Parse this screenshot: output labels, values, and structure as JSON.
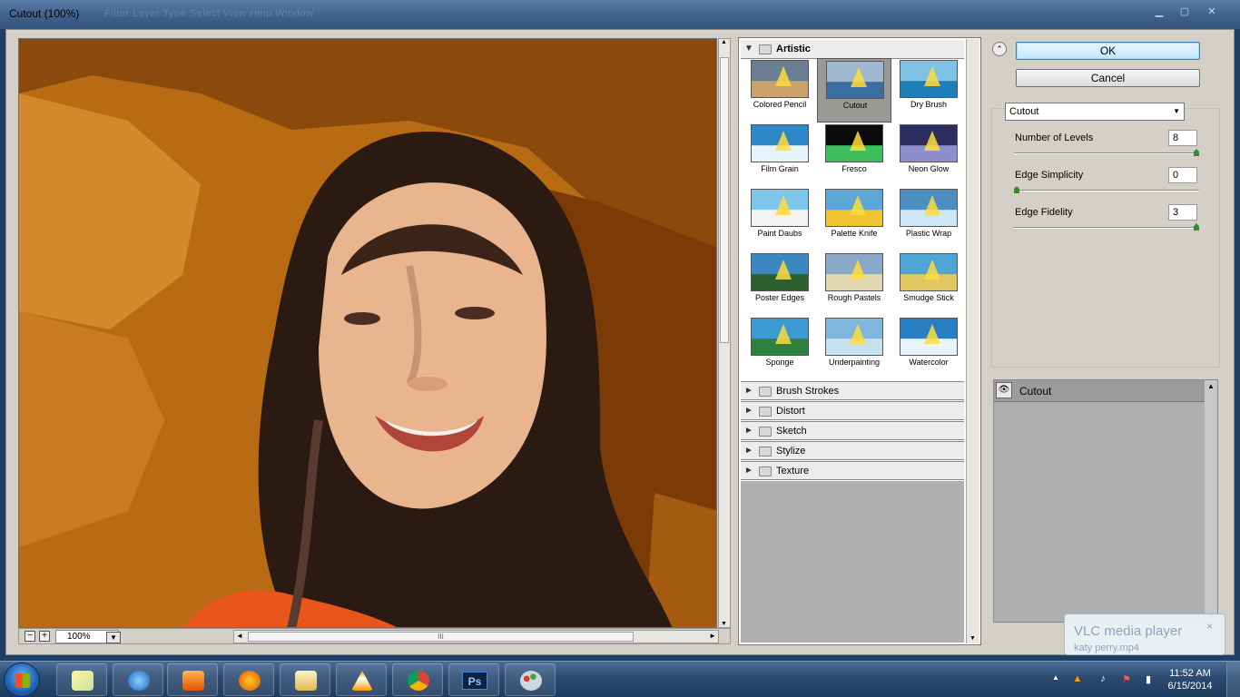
{
  "window": {
    "title": "Cutout (100%)",
    "ghost_menu": "Filter   Layer   Type   Select   View   Help   Window"
  },
  "preview": {
    "zoom_value": "100%",
    "zoom_out_glyph": "−",
    "zoom_in_glyph": "+",
    "dropdown_glyph": "▼",
    "hscroll_glyph": "III",
    "vscroll_up": "▲",
    "vscroll_down": "▼",
    "hscroll_left": "◄",
    "hscroll_right": "►"
  },
  "gallery": {
    "expanded_category": "Artistic",
    "thumbnails": [
      {
        "label": "Colored Pencil",
        "selected": false
      },
      {
        "label": "Cutout",
        "selected": true
      },
      {
        "label": "Dry Brush",
        "selected": false
      },
      {
        "label": "Film Grain",
        "selected": false
      },
      {
        "label": "Fresco",
        "selected": false
      },
      {
        "label": "Neon Glow",
        "selected": false
      },
      {
        "label": "Paint Daubs",
        "selected": false
      },
      {
        "label": "Palette Knife",
        "selected": false
      },
      {
        "label": "Plastic Wrap",
        "selected": false
      },
      {
        "label": "Poster Edges",
        "selected": false
      },
      {
        "label": "Rough Pastels",
        "selected": false
      },
      {
        "label": "Smudge Stick",
        "selected": false
      },
      {
        "label": "Sponge",
        "selected": false
      },
      {
        "label": "Underpainting",
        "selected": false
      },
      {
        "label": "Watercolor",
        "selected": false
      }
    ],
    "collapsed_categories": [
      "Brush Strokes",
      "Distort",
      "Sketch",
      "Stylize",
      "Texture"
    ],
    "expanded_glyph": "▼",
    "collapsed_glyph": "►",
    "vscroll_down": "▼"
  },
  "actions": {
    "collapse_glyph": "⌃",
    "ok_label": "OK",
    "cancel_label": "Cancel"
  },
  "settings": {
    "filter_selected": "Cutout",
    "filter_arrow": "▼",
    "params": [
      {
        "label": "Number of Levels",
        "value": "8",
        "slider_fraction": 1.0
      },
      {
        "label": "Edge Simplicity",
        "value": "0",
        "slider_fraction": 0.0
      },
      {
        "label": "Edge Fidelity",
        "value": "3",
        "slider_fraction": 1.0
      }
    ]
  },
  "layers": {
    "eye_glyph": "👁",
    "effect_layers": [
      {
        "label": "Cutout"
      }
    ],
    "vscroll_up": "▲",
    "vscroll_down": "▼"
  },
  "notification": {
    "title": "VLC media player",
    "subtitle": "katy perry.mp4",
    "close_glyph": "×"
  },
  "taskbar": {
    "photoshop_label": "Ps",
    "tray_show_hidden": "▲",
    "clock_time": "11:52 AM",
    "clock_date": "6/15/2014"
  },
  "colors": {
    "preview_background": "#b96b14",
    "hair": "#2a1a12",
    "skin": "#e9b58e",
    "shirt": "#e8561b",
    "ok_accent": "#3c7fb1",
    "slider_knob": "#2f8f2f",
    "taskbar": "#2c4a70"
  }
}
